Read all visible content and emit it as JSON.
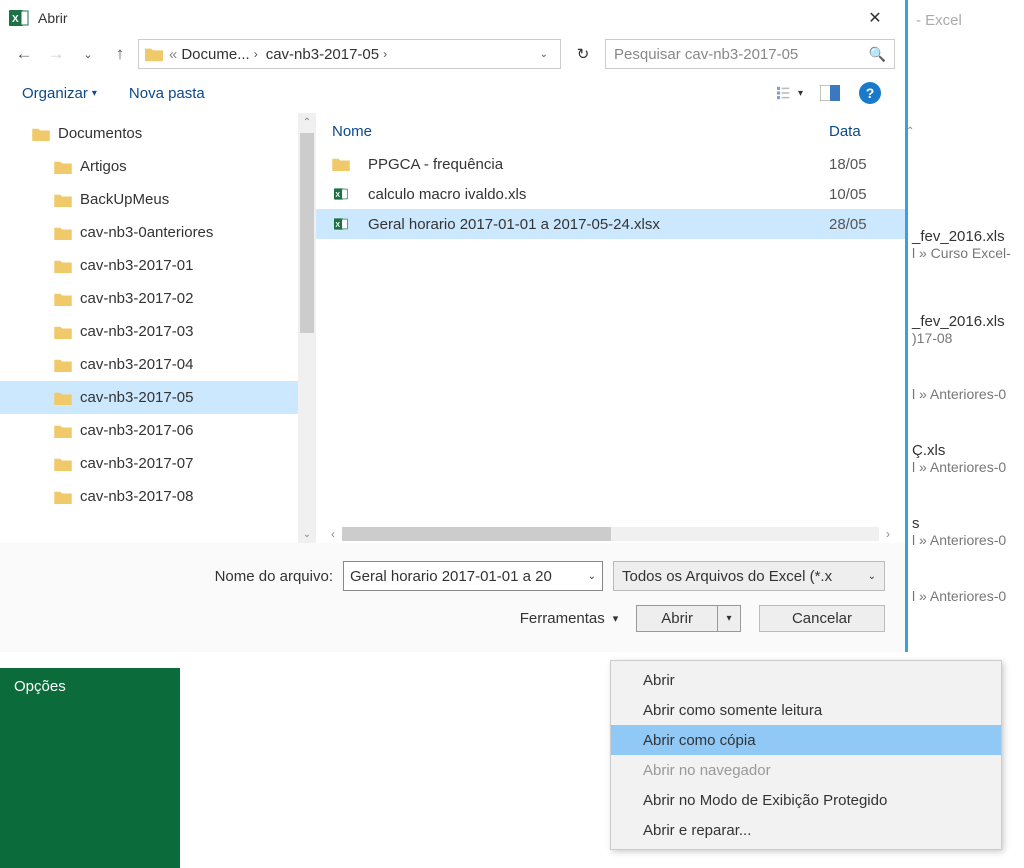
{
  "titlebar": {
    "title": "Abrir"
  },
  "breadcrumb": {
    "prefix": "«",
    "parts": [
      "Docume...",
      "cav-nb3-2017-05"
    ]
  },
  "search": {
    "placeholder": "Pesquisar cav-nb3-2017-05"
  },
  "toolbar": {
    "organize": "Organizar",
    "newfolder": "Nova pasta"
  },
  "tree": {
    "root": "Documentos",
    "items": [
      "Artigos",
      "BackUpMeus",
      "cav-nb3-0anteriores",
      "cav-nb3-2017-01",
      "cav-nb3-2017-02",
      "cav-nb3-2017-03",
      "cav-nb3-2017-04",
      "cav-nb3-2017-05",
      "cav-nb3-2017-06",
      "cav-nb3-2017-07",
      "cav-nb3-2017-08"
    ],
    "selected": "cav-nb3-2017-05"
  },
  "filelist": {
    "cols": {
      "name": "Nome",
      "date": "Data"
    },
    "rows": [
      {
        "type": "folder",
        "name": "PPGCA - frequência",
        "date": "18/05"
      },
      {
        "type": "xls",
        "name": "calculo macro ivaldo.xls",
        "date": "10/05"
      },
      {
        "type": "xlsx",
        "name": "Geral horario 2017-01-01 a 2017-05-24.xlsx",
        "date": "28/05",
        "selected": true
      }
    ]
  },
  "bottom": {
    "filename_label": "Nome do arquivo:",
    "filename_value": "Geral horario 2017-01-01 a 20",
    "filter": "Todos os Arquivos do Excel (*.x",
    "tools": "Ferramentas",
    "open": "Abrir",
    "cancel": "Cancelar"
  },
  "menu": {
    "items": [
      {
        "label": "Abrir"
      },
      {
        "label": "Abrir como somente leitura"
      },
      {
        "label": "Abrir como cópia",
        "highlight": true
      },
      {
        "label": "Abrir no navegador",
        "disabled": true
      },
      {
        "label": "Abrir no Modo de Exibição Protegido"
      },
      {
        "label": "Abrir e reparar..."
      }
    ]
  },
  "backstage": {
    "options": "Opções"
  },
  "behind": {
    "app": "- Excel",
    "items": [
      {
        "name": "_fev_2016.xls",
        "path": "l » Curso Excel-"
      },
      {
        "name": "_fev_2016.xls",
        "path": ")17-08"
      },
      {
        "name": "",
        "path": "l » Anteriores-0"
      },
      {
        "name": "Ç.xls",
        "path": "l » Anteriores-0"
      },
      {
        "name": "s",
        "path": "l » Anteriores-0"
      },
      {
        "name": "",
        "path": "l » Anteriores-0"
      }
    ]
  }
}
